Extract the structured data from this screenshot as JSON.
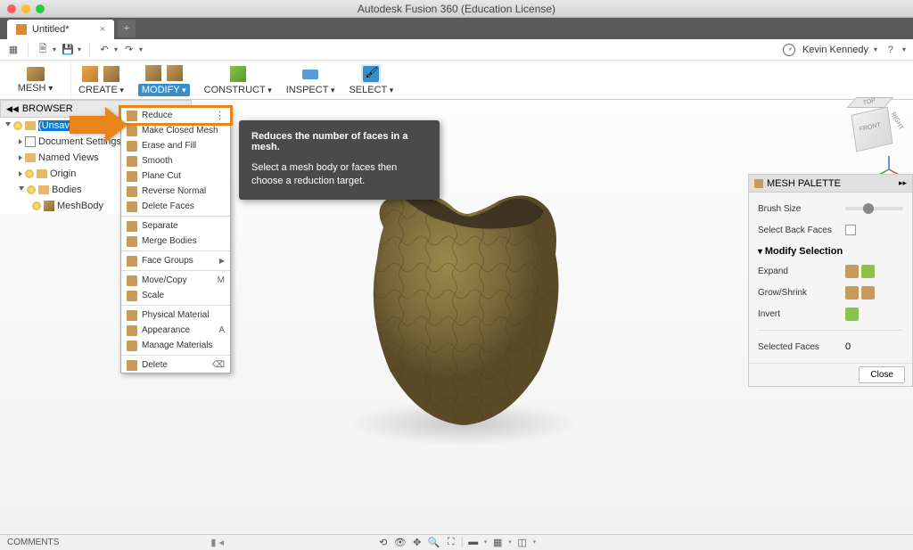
{
  "app_title": "Autodesk Fusion 360 (Education License)",
  "file_tab": {
    "name": "Untitled*",
    "close": "×"
  },
  "user": {
    "name": "Kevin Kennedy"
  },
  "workspace": {
    "label": "MESH"
  },
  "ribbon": {
    "create": "CREATE",
    "modify": "MODIFY",
    "construct": "CONSTRUCT",
    "inspect": "INSPECT",
    "select": "SELECT"
  },
  "browser": {
    "title": "BROWSER",
    "items": [
      {
        "label": "(Unsaved)",
        "selected": true
      },
      {
        "label": "Document Settings"
      },
      {
        "label": "Named Views"
      },
      {
        "label": "Origin"
      },
      {
        "label": "Bodies",
        "open": true
      },
      {
        "label": "MeshBody"
      }
    ]
  },
  "dropdown": {
    "items": [
      {
        "label": "Reduce",
        "highlight": true
      },
      {
        "label": "Make Closed Mesh"
      },
      {
        "label": "Erase and Fill"
      },
      {
        "label": "Smooth"
      },
      {
        "label": "Plane Cut"
      },
      {
        "label": "Reverse Normal"
      },
      {
        "label": "Delete Faces"
      },
      {
        "sep": true
      },
      {
        "label": "Separate"
      },
      {
        "label": "Merge Bodies"
      },
      {
        "sep": true
      },
      {
        "label": "Face Groups",
        "sub": true
      },
      {
        "sep": true
      },
      {
        "label": "Move/Copy",
        "shortcut": "M"
      },
      {
        "label": "Scale"
      },
      {
        "sep": true
      },
      {
        "label": "Physical Material"
      },
      {
        "label": "Appearance",
        "shortcut": "A"
      },
      {
        "label": "Manage Materials"
      },
      {
        "sep": true
      },
      {
        "label": "Delete",
        "shortcut": "⌫"
      }
    ]
  },
  "tooltip": {
    "title": "Reduces the number of faces in a mesh.",
    "body": "Select a mesh body or faces then choose a reduction target."
  },
  "palette": {
    "title": "MESH PALETTE",
    "brush_size": "Brush Size",
    "select_back": "Select Back Faces",
    "modify_sel": "Modify Selection",
    "expand": "Expand",
    "grow": "Grow/Shrink",
    "invert": "Invert",
    "selected_faces_label": "Selected Faces",
    "selected_faces_value": "0",
    "close_btn": "Close"
  },
  "viewcube": {
    "top": "TOP",
    "front": "FRONT",
    "right": "RIGHT"
  },
  "status": {
    "comments": "COMMENTS"
  }
}
